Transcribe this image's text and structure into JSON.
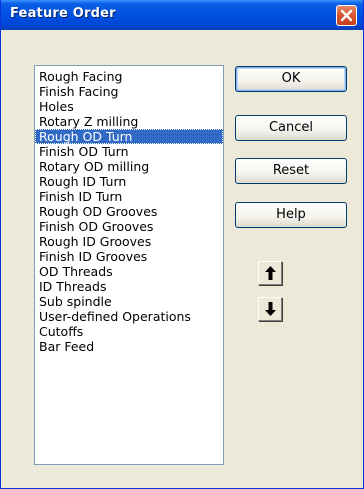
{
  "window": {
    "title": "Feature Order"
  },
  "icons": {
    "close": "close-icon",
    "move_up": "arrow-up-icon",
    "move_down": "arrow-down-icon"
  },
  "colors": {
    "titlebar": "#0054e3",
    "selection": "#316ac5",
    "close_button": "#d9572f"
  },
  "features": {
    "selected_index": 4,
    "items": [
      "Rough Facing",
      "Finish Facing",
      "Holes",
      "Rotary Z milling",
      "Rough OD Turn",
      "Finish OD Turn",
      "Rotary OD milling",
      "Rough ID Turn",
      "Finish ID Turn",
      "Rough OD Grooves",
      "Finish OD Grooves",
      "Rough ID Grooves",
      "Finish ID Grooves",
      "OD Threads",
      "ID Threads",
      "Sub spindle",
      "User-defined Operations",
      "Cutoffs",
      "Bar Feed"
    ]
  },
  "buttons": {
    "ok": "OK",
    "cancel": "Cancel",
    "reset": "Reset",
    "help": "Help"
  }
}
